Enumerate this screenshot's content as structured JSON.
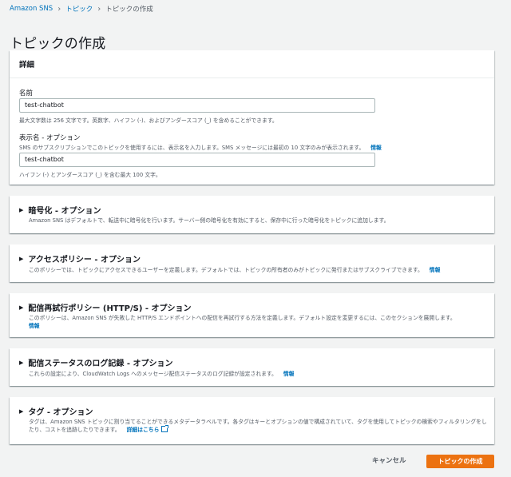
{
  "breadcrumb": {
    "root": "Amazon SNS",
    "parent": "トピック",
    "current": "トピックの作成"
  },
  "page_title": "トピックの作成",
  "details": {
    "header": "詳細",
    "name_label": "名前",
    "name_value": "test-chatbot",
    "name_hint": "最大文字数は 256 文字です。英数字、ハイフン (-)、およびアンダースコア (_) を含めることができます。",
    "display_label": "表示名 - オプション",
    "display_desc": "SMS のサブスクリプションでこのトピックを使用するには、表示名を入力します。SMS メッセージには最初の 10 文字のみが表示されます。",
    "display_info": "情報",
    "display_value": "test-chatbot",
    "display_hint": "ハイフン (-) とアンダースコア (_) を含む最大 100 文字。"
  },
  "sections": {
    "encryption": {
      "title": "暗号化 - オプション",
      "desc": "Amazon SNS はデフォルトで、転送中に暗号化を行います。サーバー側の暗号化を有効にすると、保存中に行った暗号化をトピックに追加します。"
    },
    "access": {
      "title": "アクセスポリシー - オプション",
      "desc": "このポリシーでは、トピックにアクセスできるユーザーを定義します。デフォルトでは、トピックの所有者のみがトピックに発行またはサブスクライブできます。",
      "info": "情報"
    },
    "retry": {
      "title": "配信再試行ポリシー (HTTP/S) - オプション",
      "desc": "このポリシーは、Amazon SNS が失敗した HTTP/S エンドポイントへの配信を再試行する方法を定義します。デフォルト設定を変更するには、このセクションを展開します。",
      "info": "情報"
    },
    "logging": {
      "title": "配信ステータスのログ記録 - オプション",
      "desc": "これらの設定により、CloudWatch Logs へのメッセージ配信ステータスのログ記録が設定されます。",
      "info": "情報"
    },
    "tags": {
      "title": "タグ - オプション",
      "desc": "タグは、Amazon SNS トピックに割り当てることができるメタデータラベルです。各タグはキーとオプションの値で構成されていて、タグを使用してトピックの検索やフィルタリングをしたり、コストを追跡したりできます。",
      "more": "詳細はこちら"
    }
  },
  "footer": {
    "cancel": "キャンセル",
    "create": "トピックの作成"
  }
}
